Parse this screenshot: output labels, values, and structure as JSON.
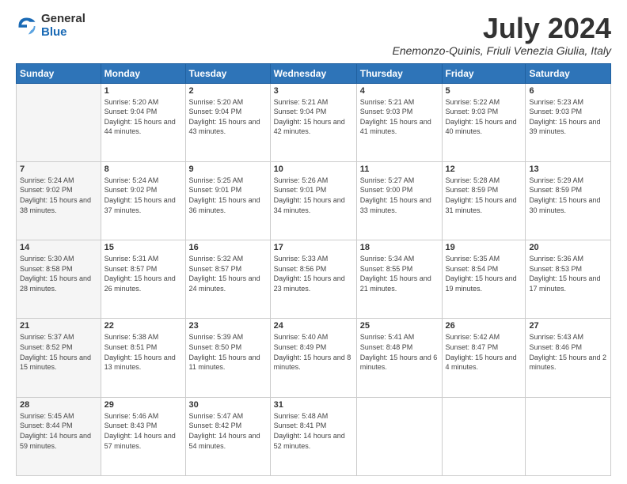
{
  "header": {
    "logo_general": "General",
    "logo_blue": "Blue",
    "month": "July 2024",
    "location": "Enemonzo-Quinis, Friuli Venezia Giulia, Italy"
  },
  "weekdays": [
    "Sunday",
    "Monday",
    "Tuesday",
    "Wednesday",
    "Thursday",
    "Friday",
    "Saturday"
  ],
  "weeks": [
    [
      {
        "day": "",
        "sunrise": "",
        "sunset": "",
        "daylight": ""
      },
      {
        "day": "1",
        "sunrise": "Sunrise: 5:20 AM",
        "sunset": "Sunset: 9:04 PM",
        "daylight": "Daylight: 15 hours and 44 minutes."
      },
      {
        "day": "2",
        "sunrise": "Sunrise: 5:20 AM",
        "sunset": "Sunset: 9:04 PM",
        "daylight": "Daylight: 15 hours and 43 minutes."
      },
      {
        "day": "3",
        "sunrise": "Sunrise: 5:21 AM",
        "sunset": "Sunset: 9:04 PM",
        "daylight": "Daylight: 15 hours and 42 minutes."
      },
      {
        "day": "4",
        "sunrise": "Sunrise: 5:21 AM",
        "sunset": "Sunset: 9:03 PM",
        "daylight": "Daylight: 15 hours and 41 minutes."
      },
      {
        "day": "5",
        "sunrise": "Sunrise: 5:22 AM",
        "sunset": "Sunset: 9:03 PM",
        "daylight": "Daylight: 15 hours and 40 minutes."
      },
      {
        "day": "6",
        "sunrise": "Sunrise: 5:23 AM",
        "sunset": "Sunset: 9:03 PM",
        "daylight": "Daylight: 15 hours and 39 minutes."
      }
    ],
    [
      {
        "day": "7",
        "sunrise": "Sunrise: 5:24 AM",
        "sunset": "Sunset: 9:02 PM",
        "daylight": "Daylight: 15 hours and 38 minutes."
      },
      {
        "day": "8",
        "sunrise": "Sunrise: 5:24 AM",
        "sunset": "Sunset: 9:02 PM",
        "daylight": "Daylight: 15 hours and 37 minutes."
      },
      {
        "day": "9",
        "sunrise": "Sunrise: 5:25 AM",
        "sunset": "Sunset: 9:01 PM",
        "daylight": "Daylight: 15 hours and 36 minutes."
      },
      {
        "day": "10",
        "sunrise": "Sunrise: 5:26 AM",
        "sunset": "Sunset: 9:01 PM",
        "daylight": "Daylight: 15 hours and 34 minutes."
      },
      {
        "day": "11",
        "sunrise": "Sunrise: 5:27 AM",
        "sunset": "Sunset: 9:00 PM",
        "daylight": "Daylight: 15 hours and 33 minutes."
      },
      {
        "day": "12",
        "sunrise": "Sunrise: 5:28 AM",
        "sunset": "Sunset: 8:59 PM",
        "daylight": "Daylight: 15 hours and 31 minutes."
      },
      {
        "day": "13",
        "sunrise": "Sunrise: 5:29 AM",
        "sunset": "Sunset: 8:59 PM",
        "daylight": "Daylight: 15 hours and 30 minutes."
      }
    ],
    [
      {
        "day": "14",
        "sunrise": "Sunrise: 5:30 AM",
        "sunset": "Sunset: 8:58 PM",
        "daylight": "Daylight: 15 hours and 28 minutes."
      },
      {
        "day": "15",
        "sunrise": "Sunrise: 5:31 AM",
        "sunset": "Sunset: 8:57 PM",
        "daylight": "Daylight: 15 hours and 26 minutes."
      },
      {
        "day": "16",
        "sunrise": "Sunrise: 5:32 AM",
        "sunset": "Sunset: 8:57 PM",
        "daylight": "Daylight: 15 hours and 24 minutes."
      },
      {
        "day": "17",
        "sunrise": "Sunrise: 5:33 AM",
        "sunset": "Sunset: 8:56 PM",
        "daylight": "Daylight: 15 hours and 23 minutes."
      },
      {
        "day": "18",
        "sunrise": "Sunrise: 5:34 AM",
        "sunset": "Sunset: 8:55 PM",
        "daylight": "Daylight: 15 hours and 21 minutes."
      },
      {
        "day": "19",
        "sunrise": "Sunrise: 5:35 AM",
        "sunset": "Sunset: 8:54 PM",
        "daylight": "Daylight: 15 hours and 19 minutes."
      },
      {
        "day": "20",
        "sunrise": "Sunrise: 5:36 AM",
        "sunset": "Sunset: 8:53 PM",
        "daylight": "Daylight: 15 hours and 17 minutes."
      }
    ],
    [
      {
        "day": "21",
        "sunrise": "Sunrise: 5:37 AM",
        "sunset": "Sunset: 8:52 PM",
        "daylight": "Daylight: 15 hours and 15 minutes."
      },
      {
        "day": "22",
        "sunrise": "Sunrise: 5:38 AM",
        "sunset": "Sunset: 8:51 PM",
        "daylight": "Daylight: 15 hours and 13 minutes."
      },
      {
        "day": "23",
        "sunrise": "Sunrise: 5:39 AM",
        "sunset": "Sunset: 8:50 PM",
        "daylight": "Daylight: 15 hours and 11 minutes."
      },
      {
        "day": "24",
        "sunrise": "Sunrise: 5:40 AM",
        "sunset": "Sunset: 8:49 PM",
        "daylight": "Daylight: 15 hours and 8 minutes."
      },
      {
        "day": "25",
        "sunrise": "Sunrise: 5:41 AM",
        "sunset": "Sunset: 8:48 PM",
        "daylight": "Daylight: 15 hours and 6 minutes."
      },
      {
        "day": "26",
        "sunrise": "Sunrise: 5:42 AM",
        "sunset": "Sunset: 8:47 PM",
        "daylight": "Daylight: 15 hours and 4 minutes."
      },
      {
        "day": "27",
        "sunrise": "Sunrise: 5:43 AM",
        "sunset": "Sunset: 8:46 PM",
        "daylight": "Daylight: 15 hours and 2 minutes."
      }
    ],
    [
      {
        "day": "28",
        "sunrise": "Sunrise: 5:45 AM",
        "sunset": "Sunset: 8:44 PM",
        "daylight": "Daylight: 14 hours and 59 minutes."
      },
      {
        "day": "29",
        "sunrise": "Sunrise: 5:46 AM",
        "sunset": "Sunset: 8:43 PM",
        "daylight": "Daylight: 14 hours and 57 minutes."
      },
      {
        "day": "30",
        "sunrise": "Sunrise: 5:47 AM",
        "sunset": "Sunset: 8:42 PM",
        "daylight": "Daylight: 14 hours and 54 minutes."
      },
      {
        "day": "31",
        "sunrise": "Sunrise: 5:48 AM",
        "sunset": "Sunset: 8:41 PM",
        "daylight": "Daylight: 14 hours and 52 minutes."
      },
      {
        "day": "",
        "sunrise": "",
        "sunset": "",
        "daylight": ""
      },
      {
        "day": "",
        "sunrise": "",
        "sunset": "",
        "daylight": ""
      },
      {
        "day": "",
        "sunrise": "",
        "sunset": "",
        "daylight": ""
      }
    ]
  ]
}
